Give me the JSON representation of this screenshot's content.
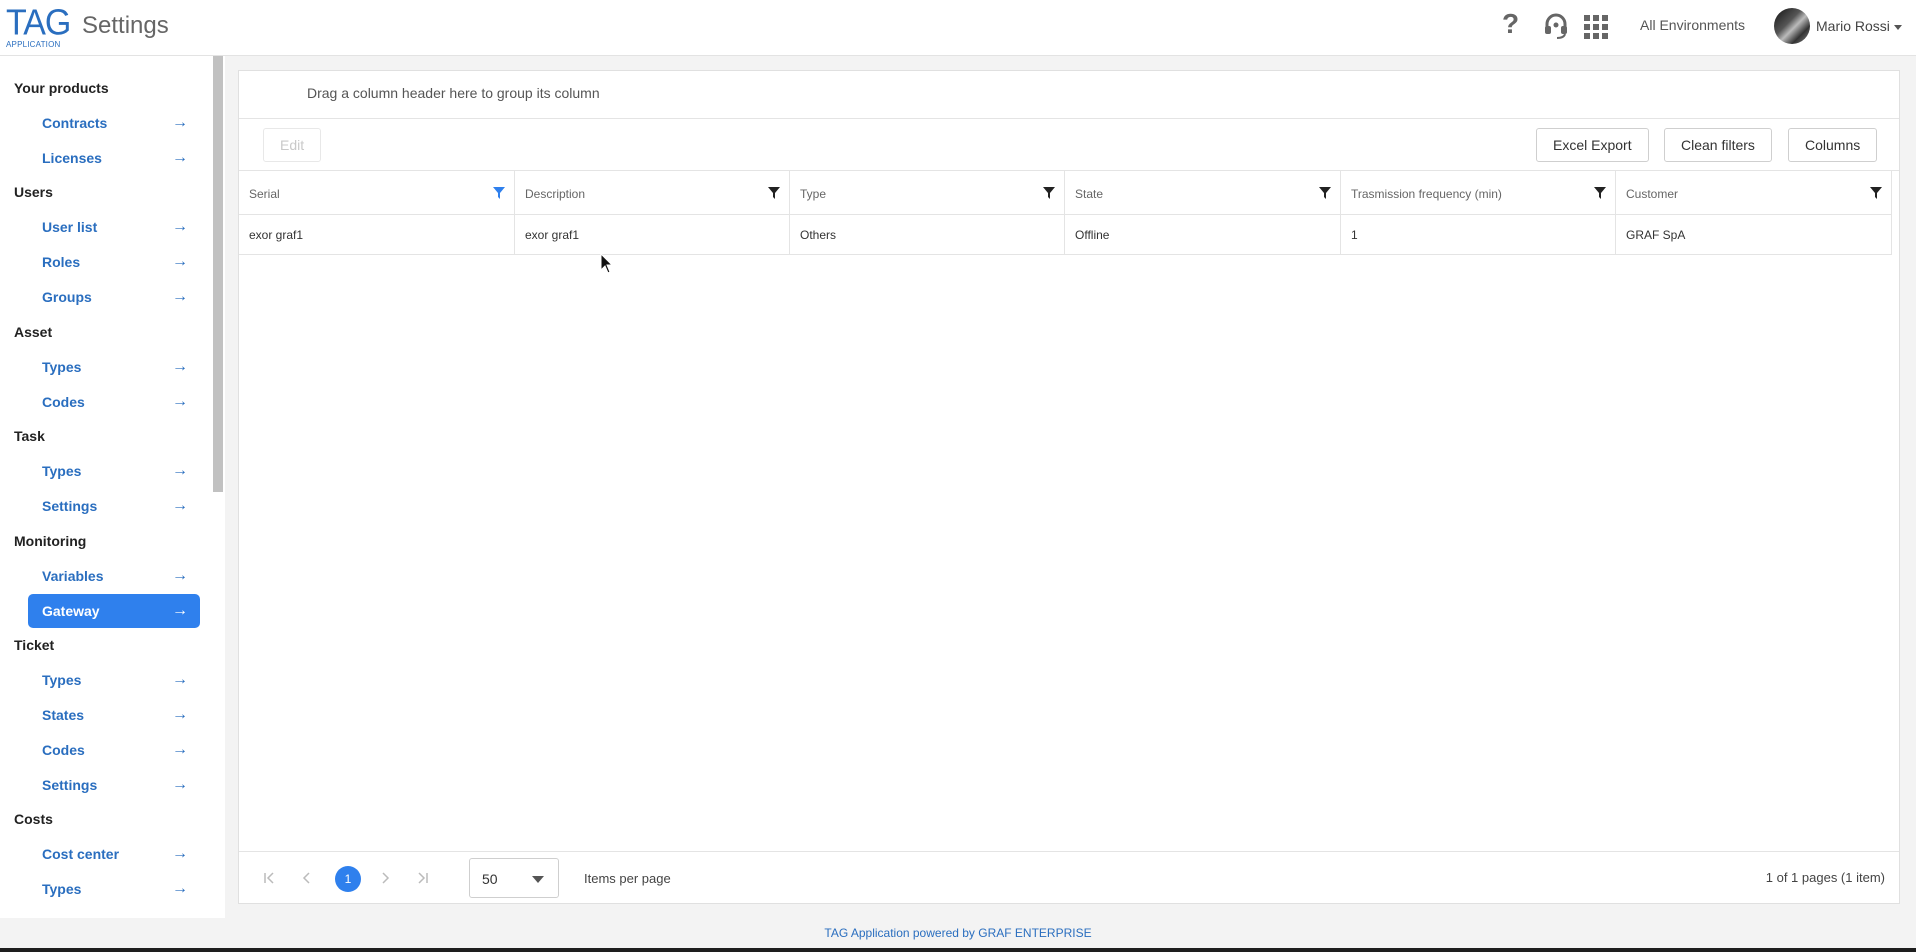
{
  "header": {
    "logo_main": "TAG",
    "logo_sub": "APPLICATION",
    "title": "Settings",
    "icons": [
      "help-icon",
      "headset-icon",
      "apps-grid-icon"
    ],
    "environment": "All Environments",
    "user_name": "Mario Rossi"
  },
  "sidebar": {
    "sections": [
      {
        "label": "Your products",
        "items": [
          "Contracts",
          "Licenses"
        ]
      },
      {
        "label": "Users",
        "items": [
          "User list",
          "Roles",
          "Groups"
        ]
      },
      {
        "label": "Asset",
        "items": [
          "Types",
          "Codes"
        ]
      },
      {
        "label": "Task",
        "items": [
          "Types",
          "Settings"
        ]
      },
      {
        "label": "Monitoring",
        "items": [
          "Variables",
          "Gateway"
        ]
      },
      {
        "label": "Ticket",
        "items": [
          "Types",
          "States",
          "Codes",
          "Settings"
        ]
      },
      {
        "label": "Costs",
        "items": [
          "Cost center",
          "Types"
        ]
      }
    ],
    "active_item": "Gateway",
    "arrow": "→"
  },
  "grid": {
    "group_hint": "Drag a column header here to group its column",
    "toolbar": {
      "edit": "Edit",
      "excel_export": "Excel Export",
      "clean_filters": "Clean filters",
      "columns": "Columns"
    },
    "columns": [
      "Serial",
      "Description",
      "Type",
      "State",
      "Trasmission frequency (min)",
      "Customer"
    ],
    "active_filter_color": "#2f80ed",
    "rows": [
      [
        "exor graf1",
        "exor graf1",
        "Others",
        "Offline",
        "1",
        "GRAF SpA"
      ]
    ],
    "pager": {
      "current_page": "1",
      "page_size": "50",
      "items_per_page_label": "Items per page",
      "info": "1 of 1 pages (1 item)"
    }
  },
  "footer": {
    "text": "TAG Application powered by GRAF ENTERPRISE"
  },
  "colors": {
    "accent": "#2f80ed",
    "link": "#2a6ebf"
  }
}
